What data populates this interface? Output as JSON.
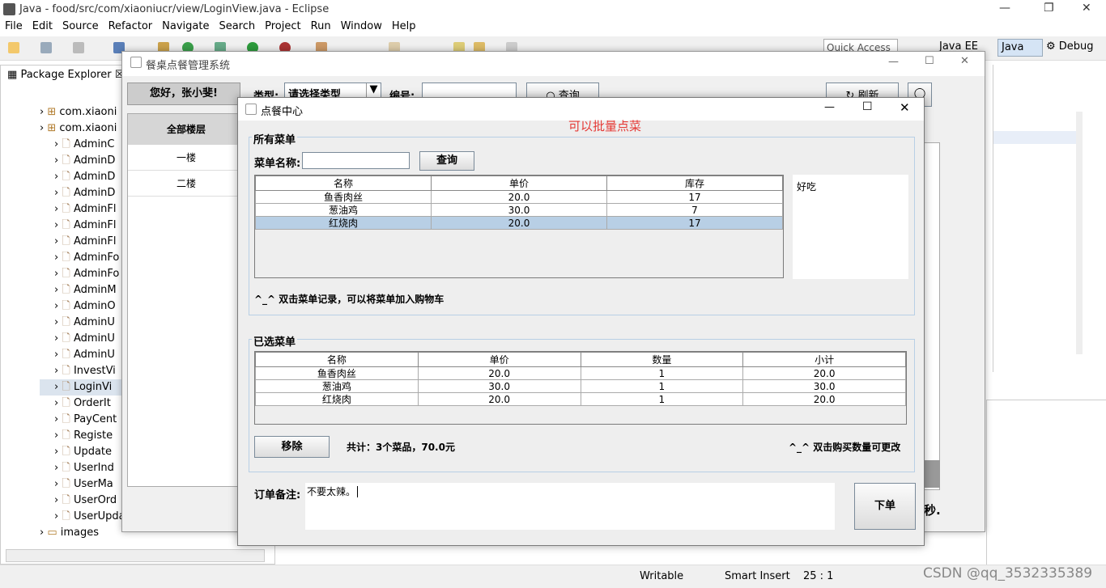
{
  "window": {
    "title": "Java - food/src/com/xiaoniucr/view/LoginView.java - Eclipse"
  },
  "menu": [
    "File",
    "Edit",
    "Source",
    "Refactor",
    "Navigate",
    "Search",
    "Project",
    "Run",
    "Window",
    "Help"
  ],
  "quick_access": "Quick Access",
  "perspectives": {
    "javaee": "Java EE",
    "java": "Java",
    "debug": "Debug"
  },
  "package_explorer": {
    "title": "Package Explorer",
    "packages": [
      "com.xiaoni",
      "com.xiaoni"
    ],
    "files": [
      "AdminC",
      "AdminD",
      "AdminD",
      "AdminD",
      "AdminFl",
      "AdminFl",
      "AdminFl",
      "AdminFo",
      "AdminFo",
      "AdminM",
      "AdminO",
      "AdminU",
      "AdminU",
      "AdminU",
      "InvestVi",
      "LoginVi",
      "OrderIt",
      "PayCent",
      "Registe",
      "Update",
      "UserInd",
      "UserMa",
      "UserOrd",
      "UserUpdateProfileView.java"
    ],
    "last": "images"
  },
  "status": {
    "writable": "Writable",
    "insert": "Smart Insert",
    "pos": "25 : 1"
  },
  "watermark": "CSDN @qq_3532335389",
  "main_window": {
    "title": "餐桌点餐管理系统",
    "greeting": "您好，张小斐!",
    "type_label": "类型:",
    "type_value": "请选择类型",
    "number_label": "编号:",
    "query": "查询",
    "refresh": "刷新",
    "floors_header": "全部楼层",
    "floors": [
      "一楼",
      "二楼"
    ],
    "right_bottom_text": "秒."
  },
  "dialog": {
    "title": "点餐中心",
    "annotation": "可以批量点菜",
    "all_menu": {
      "label": "所有菜单",
      "search_label": "菜单名称:",
      "search_value": "",
      "query": "查询",
      "headers": [
        "名称",
        "单价",
        "库存"
      ],
      "rows": [
        {
          "name": "鱼香肉丝",
          "price": "20.0",
          "stock": "17"
        },
        {
          "name": "葱油鸡",
          "price": "30.0",
          "stock": "7"
        },
        {
          "name": "红烧肉",
          "price": "20.0",
          "stock": "17"
        }
      ],
      "description": "好吃",
      "tip": "^_^ 双击菜单记录，可以将菜单加入购物车"
    },
    "selected_menu": {
      "label": "已选菜单",
      "headers": [
        "名称",
        "单价",
        "数量",
        "小计"
      ],
      "rows": [
        {
          "name": "鱼香肉丝",
          "price": "20.0",
          "qty": "1",
          "subtotal": "20.0"
        },
        {
          "name": "葱油鸡",
          "price": "30.0",
          "qty": "1",
          "subtotal": "30.0"
        },
        {
          "name": "红烧肉",
          "price": "20.0",
          "qty": "1",
          "subtotal": "20.0"
        }
      ],
      "remove": "移除",
      "total": "共计：3个菜品，70.0元",
      "tip": "^_^ 双击购买数量可更改"
    },
    "remark_label": "订单备注:",
    "remark_value": "不要太辣。",
    "order_button": "下单"
  }
}
